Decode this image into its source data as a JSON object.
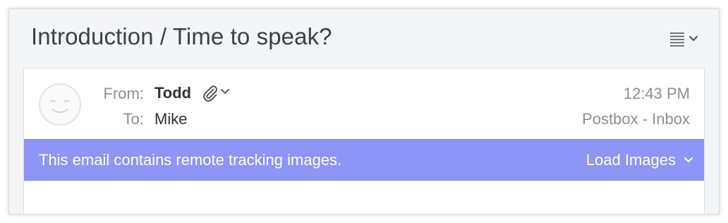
{
  "message": {
    "subject": "Introduction / Time to speak?",
    "from_label": "From:",
    "from_name": "Todd",
    "to_label": "To:",
    "to_name": "Mike",
    "time": "12:43 PM",
    "folder": "Postbox - Inbox"
  },
  "tracking_notice": {
    "text": "This email contains remote tracking images.",
    "action_label": "Load Images",
    "background_color": "#8d95f5"
  },
  "icons": {
    "menu": "list-menu-icon",
    "avatar": "smiley-avatar-icon",
    "attachment": "paperclip-icon",
    "dropdown": "chevron-down-icon"
  }
}
